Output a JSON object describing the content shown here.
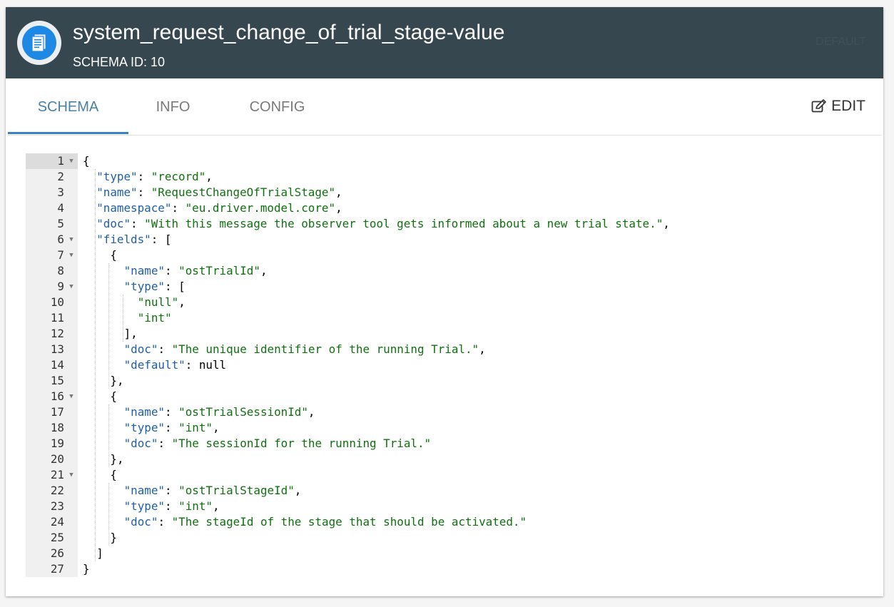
{
  "header": {
    "title": "system_request_change_of_trial_stage-value",
    "schema_id": "SCHEMA ID: 10",
    "faint_label": "DEFAULT"
  },
  "tabs": [
    {
      "label": "SCHEMA",
      "active": true
    },
    {
      "label": "INFO",
      "active": false
    },
    {
      "label": "CONFIG",
      "active": false
    }
  ],
  "edit_label": "EDIT",
  "editor": {
    "lines": [
      {
        "n": "1",
        "fold": true,
        "indent": 0,
        "parts": [
          [
            "p",
            "{"
          ]
        ]
      },
      {
        "n": "2",
        "fold": false,
        "indent": 1,
        "parts": [
          [
            "k",
            "\"type\""
          ],
          [
            "p",
            ": "
          ],
          [
            "s",
            "\"record\""
          ],
          [
            "p",
            ","
          ]
        ]
      },
      {
        "n": "3",
        "fold": false,
        "indent": 1,
        "parts": [
          [
            "k",
            "\"name\""
          ],
          [
            "p",
            ": "
          ],
          [
            "s",
            "\"RequestChangeOfTrialStage\""
          ],
          [
            "p",
            ","
          ]
        ]
      },
      {
        "n": "4",
        "fold": false,
        "indent": 1,
        "parts": [
          [
            "k",
            "\"namespace\""
          ],
          [
            "p",
            ": "
          ],
          [
            "s",
            "\"eu.driver.model.core\""
          ],
          [
            "p",
            ","
          ]
        ]
      },
      {
        "n": "5",
        "fold": false,
        "indent": 1,
        "parts": [
          [
            "k",
            "\"doc\""
          ],
          [
            "p",
            ": "
          ],
          [
            "s",
            "\"With this message the observer tool gets informed about a new trial state.\""
          ],
          [
            "p",
            ","
          ]
        ]
      },
      {
        "n": "6",
        "fold": true,
        "indent": 1,
        "parts": [
          [
            "k",
            "\"fields\""
          ],
          [
            "p",
            ": ["
          ]
        ]
      },
      {
        "n": "7",
        "fold": true,
        "indent": 2,
        "parts": [
          [
            "p",
            "{"
          ]
        ]
      },
      {
        "n": "8",
        "fold": false,
        "indent": 3,
        "parts": [
          [
            "k",
            "\"name\""
          ],
          [
            "p",
            ": "
          ],
          [
            "s",
            "\"ostTrialId\""
          ],
          [
            "p",
            ","
          ]
        ]
      },
      {
        "n": "9",
        "fold": true,
        "indent": 3,
        "parts": [
          [
            "k",
            "\"type\""
          ],
          [
            "p",
            ": ["
          ]
        ]
      },
      {
        "n": "10",
        "fold": false,
        "indent": 4,
        "parts": [
          [
            "s",
            "\"null\""
          ],
          [
            "p",
            ","
          ]
        ]
      },
      {
        "n": "11",
        "fold": false,
        "indent": 4,
        "parts": [
          [
            "s",
            "\"int\""
          ]
        ]
      },
      {
        "n": "12",
        "fold": false,
        "indent": 3,
        "parts": [
          [
            "p",
            "],"
          ]
        ]
      },
      {
        "n": "13",
        "fold": false,
        "indent": 3,
        "parts": [
          [
            "k",
            "\"doc\""
          ],
          [
            "p",
            ": "
          ],
          [
            "s",
            "\"The unique identifier of the running Trial.\""
          ],
          [
            "p",
            ","
          ]
        ]
      },
      {
        "n": "14",
        "fold": false,
        "indent": 3,
        "parts": [
          [
            "k",
            "\"default\""
          ],
          [
            "p",
            ": null"
          ]
        ]
      },
      {
        "n": "15",
        "fold": false,
        "indent": 2,
        "parts": [
          [
            "p",
            "},"
          ]
        ]
      },
      {
        "n": "16",
        "fold": true,
        "indent": 2,
        "parts": [
          [
            "p",
            "{"
          ]
        ]
      },
      {
        "n": "17",
        "fold": false,
        "indent": 3,
        "parts": [
          [
            "k",
            "\"name\""
          ],
          [
            "p",
            ": "
          ],
          [
            "s",
            "\"ostTrialSessionId\""
          ],
          [
            "p",
            ","
          ]
        ]
      },
      {
        "n": "18",
        "fold": false,
        "indent": 3,
        "parts": [
          [
            "k",
            "\"type\""
          ],
          [
            "p",
            ": "
          ],
          [
            "s",
            "\"int\""
          ],
          [
            "p",
            ","
          ]
        ]
      },
      {
        "n": "19",
        "fold": false,
        "indent": 3,
        "parts": [
          [
            "k",
            "\"doc\""
          ],
          [
            "p",
            ": "
          ],
          [
            "s",
            "\"The sessionId for the running Trial.\""
          ]
        ]
      },
      {
        "n": "20",
        "fold": false,
        "indent": 2,
        "parts": [
          [
            "p",
            "},"
          ]
        ]
      },
      {
        "n": "21",
        "fold": true,
        "indent": 2,
        "parts": [
          [
            "p",
            "{"
          ]
        ]
      },
      {
        "n": "22",
        "fold": false,
        "indent": 3,
        "parts": [
          [
            "k",
            "\"name\""
          ],
          [
            "p",
            ": "
          ],
          [
            "s",
            "\"ostTrialStageId\""
          ],
          [
            "p",
            ","
          ]
        ]
      },
      {
        "n": "23",
        "fold": false,
        "indent": 3,
        "parts": [
          [
            "k",
            "\"type\""
          ],
          [
            "p",
            ": "
          ],
          [
            "s",
            "\"int\""
          ],
          [
            "p",
            ","
          ]
        ]
      },
      {
        "n": "24",
        "fold": false,
        "indent": 3,
        "parts": [
          [
            "k",
            "\"doc\""
          ],
          [
            "p",
            ": "
          ],
          [
            "s",
            "\"The stageId of the stage that should be activated.\""
          ]
        ]
      },
      {
        "n": "25",
        "fold": false,
        "indent": 2,
        "parts": [
          [
            "p",
            "}"
          ]
        ]
      },
      {
        "n": "26",
        "fold": false,
        "indent": 1,
        "parts": [
          [
            "p",
            "]"
          ]
        ]
      },
      {
        "n": "27",
        "fold": false,
        "indent": 0,
        "parts": [
          [
            "p",
            "}"
          ]
        ]
      }
    ]
  },
  "colors": {
    "header_bg": "#37474f",
    "accent": "#3b82c4",
    "key": "#1f5fa8",
    "string": "#107010"
  }
}
